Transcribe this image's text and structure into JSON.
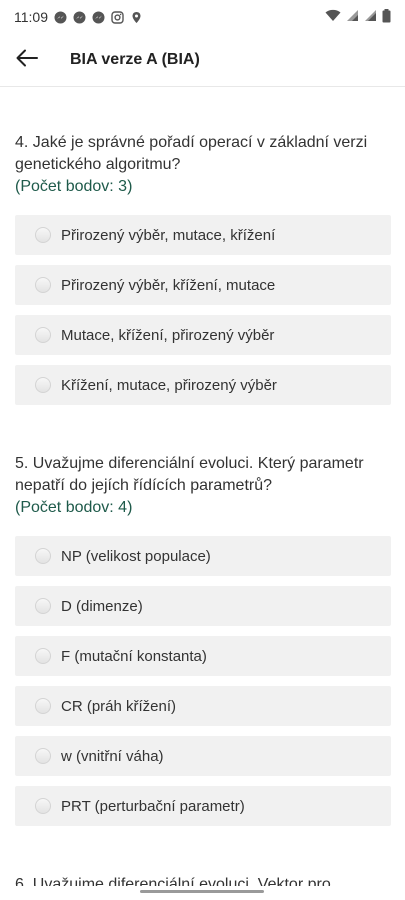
{
  "status": {
    "time": "11:09",
    "left_icons": [
      "messenger-icon",
      "messenger-icon",
      "messenger-icon",
      "instagram-icon",
      "location-icon"
    ],
    "right_icons": [
      "wifi-icon",
      "signal-icon",
      "signal-r-icon",
      "battery-icon"
    ]
  },
  "header": {
    "back_icon": "arrow-left-icon",
    "title": "BIA verze A (BIA)"
  },
  "questions": [
    {
      "text": "4. Jaké je správné pořadí operací v základní verzi genetického algoritmu?",
      "points": "(Počet bodov: 3)",
      "options": [
        "Přirozený výběr, mutace, křížení",
        "Přirozený výběr, křížení, mutace",
        "Mutace, křížení, přirozený výběr",
        "Křížení, mutace, přirozený výběr"
      ]
    },
    {
      "text": "5. Uvažujme diferenciální evoluci. Který parametr nepatří do jejích řídících parametrů?",
      "points": "(Počet bodov: 4)",
      "options": [
        "NP (velikost populace)",
        "D (dimenze)",
        "F (mutační konstanta)",
        "CR (práh křížení)",
        "w (vnitřní váha)",
        "PRT (perturbační parametr)"
      ]
    }
  ],
  "next_question_partial": "6. Uvažujme diferenciální evoluci. Vektor pro"
}
